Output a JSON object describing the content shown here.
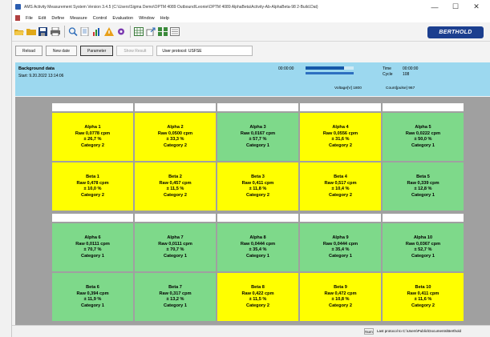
{
  "window": {
    "title": "AMS   Activity Measurement System    Version 3.4.5   (C:\\Users\\Sigma Demo\\OPTM 4089 Outbound\\Leonie\\OPTM 4089 AlphaBeta\\Activity-Ab-AlphaBeta-98 2-Build.Dat)",
    "min_icon": "—",
    "max_icon": "☐",
    "close_icon": "✕"
  },
  "menu": [
    "File",
    "Edit",
    "Define",
    "Measure",
    "Control",
    "Evaluation",
    "Window",
    "Help"
  ],
  "toolbar": {
    "icons": [
      "open-folder-icon",
      "folder-icon",
      "save-icon",
      "print-icon",
      "search-icon",
      "report-icon",
      "chart-icon",
      "alert-icon",
      "settings-icon",
      "table-icon",
      "export-icon",
      "grid-icon",
      "list-icon"
    ],
    "brand_logo": "BERTHOLD"
  },
  "actions": {
    "reload": "Reload",
    "new_date": "New date",
    "parameter": "Parameter",
    "show_result": "Show Result",
    "protocol": "User protocol: USFSE"
  },
  "status": {
    "title": "Background data",
    "start": "Start:   9.20.2022   13:14:06",
    "elapsed": "00:00:00",
    "progress_fraction": 0.8,
    "time_label": "Time",
    "time_value": "00:00:00",
    "cycle_label": "Cycle",
    "cycle_value": "108",
    "voltage": "Voltage[V]   1800",
    "count": "Count[pulse]   967"
  },
  "colors": {
    "yellow": "#ffff00",
    "green": "#7ed98a"
  },
  "detectors": [
    {
      "alpha": {
        "name": "Alpha 1",
        "raw": "Raw 0,0778 cpm",
        "err": "± 26,7 %",
        "category": "Category 2",
        "color": "yellow"
      },
      "beta": {
        "name": "Beta 1",
        "raw": "Raw 0,478 cpm",
        "err": "± 10,0 %",
        "category": "Category 2",
        "color": "yellow"
      }
    },
    {
      "alpha": {
        "name": "Alpha 2",
        "raw": "Raw 0,0500 cpm",
        "err": "± 33,3 %",
        "category": "Category 2",
        "color": "yellow"
      },
      "beta": {
        "name": "Beta 2",
        "raw": "Raw 0,457 cpm",
        "err": "± 11,5 %",
        "category": "Category 2",
        "color": "yellow"
      }
    },
    {
      "alpha": {
        "name": "Alpha 3",
        "raw": "Raw 0,0167 cpm",
        "err": "± 57,7 %",
        "category": "Category 1",
        "color": "green"
      },
      "beta": {
        "name": "Beta 3",
        "raw": "Raw 0,411 cpm",
        "err": "± 11,8 %",
        "category": "Category 2",
        "color": "yellow"
      }
    },
    {
      "alpha": {
        "name": "Alpha 4",
        "raw": "Raw 0,0556 cpm",
        "err": "± 31,6 %",
        "category": "Category 2",
        "color": "yellow"
      },
      "beta": {
        "name": "Beta 4",
        "raw": "Raw 0,517 cpm",
        "err": "± 10,4 %",
        "category": "Category 2",
        "color": "yellow"
      }
    },
    {
      "alpha": {
        "name": "Alpha 5",
        "raw": "Raw 0,0222 cpm",
        "err": "± 50,0 %",
        "category": "Category 1",
        "color": "green"
      },
      "beta": {
        "name": "Beta 5",
        "raw": "Raw 0,339 cpm",
        "err": "± 12,8 %",
        "category": "Category 1",
        "color": "green"
      }
    },
    {
      "alpha": {
        "name": "Alpha 6",
        "raw": "Raw 0,0111 cpm",
        "err": "± 70,7 %",
        "category": "Category 1",
        "color": "green"
      },
      "beta": {
        "name": "Beta 6",
        "raw": "Raw 0,394 cpm",
        "err": "± 11,9 %",
        "category": "Category 1",
        "color": "green"
      }
    },
    {
      "alpha": {
        "name": "Alpha 7",
        "raw": "Raw 0,0111 cpm",
        "err": "± 70,7 %",
        "category": "Category 1",
        "color": "green"
      },
      "beta": {
        "name": "Beta 7",
        "raw": "Raw 0,317 cpm",
        "err": "± 13,2 %",
        "category": "Category 1",
        "color": "green"
      }
    },
    {
      "alpha": {
        "name": "Alpha 8",
        "raw": "Raw 0,0444 cpm",
        "err": "± 35,4 %",
        "category": "Category 1",
        "color": "green"
      },
      "beta": {
        "name": "Beta 8",
        "raw": "Raw 0,422 cpm",
        "err": "± 11,5 %",
        "category": "Category 2",
        "color": "yellow"
      }
    },
    {
      "alpha": {
        "name": "Alpha 9",
        "raw": "Raw 0,0444 cpm",
        "err": "± 35,4 %",
        "category": "Category 1",
        "color": "green"
      },
      "beta": {
        "name": "Beta 9",
        "raw": "Raw 0,472 cpm",
        "err": "± 10,8 %",
        "category": "Category 2",
        "color": "yellow"
      }
    },
    {
      "alpha": {
        "name": "Alpha 10",
        "raw": "Raw 0,0367 cpm",
        "err": "± 52,7 %",
        "category": "Category 1",
        "color": "green"
      },
      "beta": {
        "name": "Beta 10",
        "raw": "Raw 0,411 cpm",
        "err": "± 11,6 %",
        "category": "Category 2",
        "color": "yellow"
      }
    }
  ],
  "statusbar": {
    "field": "Num",
    "path": "Last protocol to   C:\\Users\\Public\\Documents\\Berthold"
  }
}
